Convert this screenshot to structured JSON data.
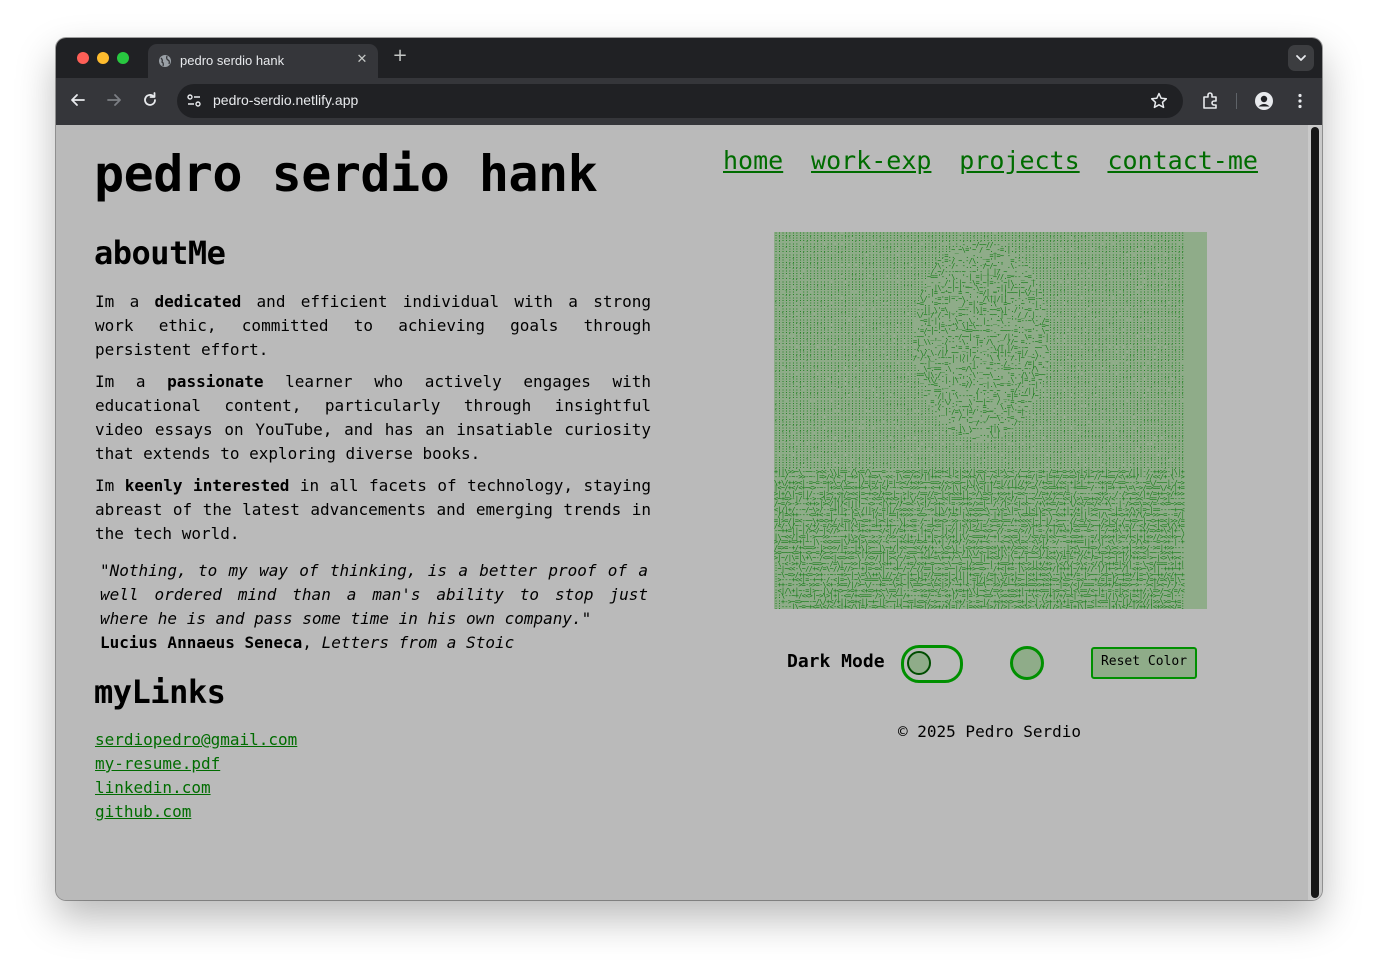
{
  "browser": {
    "tab_title": "pedro serdio hank",
    "url": "pedro-serdio.netlify.app",
    "icons": [
      "globe-icon",
      "close-icon",
      "plus-icon",
      "chevron-down-icon",
      "back-arrow-icon",
      "forward-arrow-icon",
      "reload-icon",
      "site-info-icon",
      "star-icon",
      "extensions-icon",
      "profile-icon",
      "more-vert-icon"
    ]
  },
  "header": {
    "title": "pedro serdio hank"
  },
  "nav": {
    "items": [
      "home",
      "work-exp",
      "projects",
      "contact-me"
    ]
  },
  "about": {
    "heading": "aboutMe",
    "p1": {
      "pre": "Im a ",
      "bold": "dedicated",
      "post": " and efficient individual with a strong work ethic, committed to achieving goals through persistent effort."
    },
    "p2": {
      "pre": "Im a ",
      "bold": "passionate",
      "post": " learner who actively engages with educational content, particularly through insightful video essays on YouTube, and has an insatiable curiosity that extends to exploring diverse books."
    },
    "p3": {
      "pre": "Im ",
      "bold": "keenly interested",
      "post": " in all facets of technology, staying abreast of the latest advancements and emerging trends in the tech world."
    }
  },
  "quote": {
    "text": "\"Nothing, to my way of thinking, is a better proof of a well ordered mind than a man's ability to stop just where he is and pass some time in his own company.\"",
    "author": "Lucius Annaeus Seneca",
    "separator": ", ",
    "source": "Letters from a Stoic"
  },
  "links": {
    "heading": "myLinks",
    "items": [
      "serdiopedro@gmail.com",
      "my-resume.pdf",
      "linkedin.com",
      "github.com"
    ]
  },
  "controls": {
    "dark_mode_label": "Dark Mode",
    "dark_mode_on": false,
    "reset_label": "Reset Color"
  },
  "footer": {
    "text": "© 2025 Pedro Serdio"
  },
  "colors": {
    "page_background": "#bababa",
    "accent_green": "#009000",
    "link_green": "#006c00",
    "art_background": "#8fac89",
    "chrome_dark": "#202124",
    "chrome_tab": "#35363a"
  }
}
